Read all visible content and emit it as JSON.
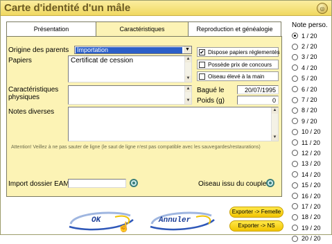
{
  "window": {
    "title": "Carte d'identité d'un mâle"
  },
  "tabs": [
    {
      "label": "Présentation"
    },
    {
      "label": "Caractéristiques"
    },
    {
      "label": "Reproduction et généalogie"
    }
  ],
  "form": {
    "origine_label": "Origine des parents",
    "origine_value": "Importation",
    "papiers_label": "Papiers",
    "papiers_value": "Certificat de cession",
    "caracteristiques_label": "Caractéristiques physiques",
    "notes_label": "Notes diverses",
    "warning": "Attention! Veillez à ne pas sauter de ligne (le saut de ligne n'est pas compatible avec les sauvegardes/restaurations)",
    "import_label": "Import dossier EAM",
    "import_value": "",
    "oiseau_couple_label": "Oiseau issu du couple:",
    "bague_label": "Bagué le",
    "bague_value": "20/07/1995",
    "poids_label": "Poids (g)",
    "poids_value": "0"
  },
  "checkboxes": [
    {
      "label": "Dispose papiers réglementés",
      "checked": true
    },
    {
      "label": "Possède prix de concours",
      "checked": false
    },
    {
      "label": "Oiseau élevé à la main",
      "checked": false
    }
  ],
  "note_perso": {
    "title": "Note perso.",
    "selected": "1 / 20",
    "options": [
      "1 / 20",
      "2 / 20",
      "3 / 20",
      "4 / 20",
      "5 / 20",
      "6 / 20",
      "7 / 20",
      "8 / 20",
      "9 / 20",
      "10 / 20",
      "11 / 20",
      "12 / 20",
      "13 / 20",
      "14 / 20",
      "15 / 20",
      "16 / 20",
      "17 / 20",
      "18 / 20",
      "19 / 20",
      "20 / 20"
    ]
  },
  "buttons": {
    "ok": "OK",
    "annuler": "Annuler",
    "exporter_femelle": "Exporter -> Femelle",
    "exporter_ns": "Exporter -> NS"
  },
  "colors": {
    "panel": "#fcf3b5",
    "titlebar": "#f0d860",
    "accent_blue": "#1d3f98",
    "selection": "#2c5fc8"
  },
  "icons": [
    "close-icon",
    "target-picker-icon",
    "hand-cursor-icon"
  ]
}
